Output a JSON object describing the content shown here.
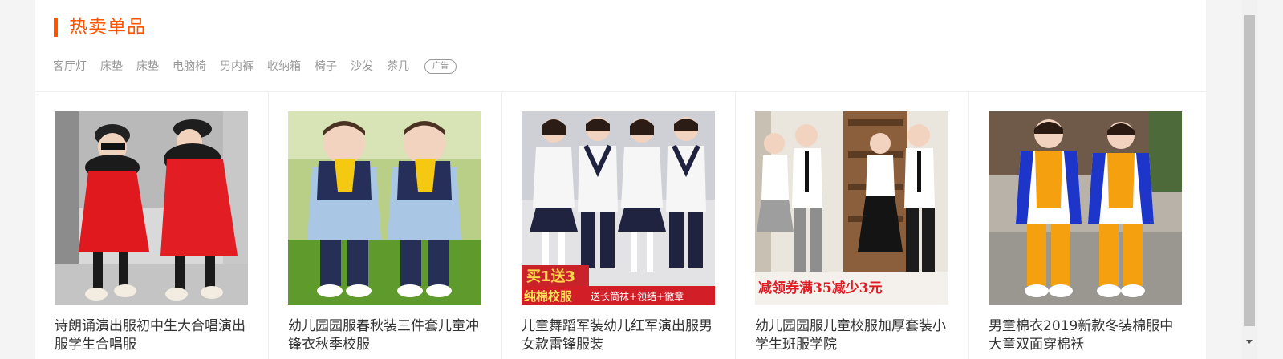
{
  "section": {
    "title": "热卖单品",
    "accent_color": "#ff5500"
  },
  "tags": [
    {
      "label": "客厅灯"
    },
    {
      "label": "床垫"
    },
    {
      "label": "床垫"
    },
    {
      "label": "电脑椅"
    },
    {
      "label": "男内裤"
    },
    {
      "label": "收纳箱"
    },
    {
      "label": "椅子"
    },
    {
      "label": "沙发"
    },
    {
      "label": "茶几"
    }
  ],
  "ad_badge": "广告",
  "products": [
    {
      "name": "诗朗诵演出服初中生大合唱演出服学生合唱服",
      "image": "kids-red-winter-coats-photo"
    },
    {
      "name": "幼儿园园服春秋装三件套儿童冲锋衣秋季校服",
      "image": "kids-yellow-navy-windbreaker-photo"
    },
    {
      "name": "儿童舞蹈军装幼儿红军演出服男女款雷锋服装",
      "image": "school-uniform-sweater-photo",
      "promo": {
        "top": "买1送3",
        "left": "纯棉校服",
        "right": "送长筒袜+领结+徽章"
      }
    },
    {
      "name": "幼儿园园服儿童校服加厚套装小学生班服学院",
      "image": "students-shirt-tie-photo",
      "promo": {
        "text": "减领券满35减少3元"
      }
    },
    {
      "name": "男童棉衣2019新款冬装棉服中大童双面穿棉袄",
      "image": "kids-orange-tracksuit-photo"
    }
  ]
}
